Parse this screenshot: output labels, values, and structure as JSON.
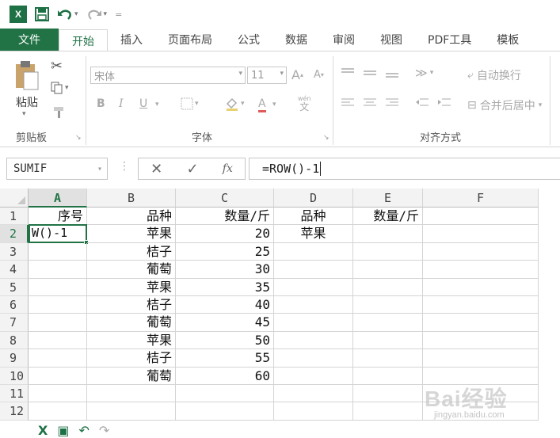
{
  "qat": {
    "logo": "X│",
    "save_icon": "save-icon",
    "undo_icon": "undo-icon",
    "redo_icon": "redo-icon",
    "customize_icon": "customize-qat-icon"
  },
  "tabs": [
    {
      "label": "文件"
    },
    {
      "label": "开始"
    },
    {
      "label": "插入"
    },
    {
      "label": "页面布局"
    },
    {
      "label": "公式"
    },
    {
      "label": "数据"
    },
    {
      "label": "审阅"
    },
    {
      "label": "视图"
    },
    {
      "label": "PDF工具"
    },
    {
      "label": "模板"
    }
  ],
  "ribbon": {
    "clipboard": {
      "paste_label": "粘贴",
      "group_label": "剪贴板"
    },
    "font": {
      "font_name": "宋体",
      "font_size": "11",
      "grow_label": "A",
      "shrink_label": "A",
      "bold_label": "B",
      "italic_label": "I",
      "underline_label": "U",
      "font_color_label": "A",
      "group_label": "字体"
    },
    "alignment": {
      "wrap_label": "自动换行",
      "merge_label": "合并后居中",
      "group_label": "对齐方式"
    }
  },
  "formula_bar": {
    "name_box": "SUMIF",
    "formula": "=ROW()-1"
  },
  "grid": {
    "columns": [
      "A",
      "B",
      "C",
      "D",
      "E",
      "F"
    ],
    "rows": [
      "1",
      "2",
      "3",
      "4",
      "5",
      "6",
      "7",
      "8",
      "9",
      "10",
      "11",
      "12"
    ],
    "active_cell_text": "W()-1",
    "cells": {
      "A1": "序号",
      "B1": "品种",
      "C1": "数量/斤",
      "D1": "品种",
      "E1": "数量/斤",
      "B2": "苹果",
      "C2": "20",
      "D2": "苹果",
      "B3": "桔子",
      "C3": "25",
      "B4": "葡萄",
      "C4": "30",
      "B5": "苹果",
      "C5": "35",
      "B6": "桔子",
      "C6": "40",
      "B7": "葡萄",
      "C7": "45",
      "B8": "苹果",
      "C8": "50",
      "B9": "桔子",
      "C9": "55",
      "B10": "葡萄",
      "C10": "60"
    }
  },
  "watermark": {
    "main": "Bai经验",
    "sub": "jingyan.baidu.com"
  },
  "colors": {
    "excel_green": "#217346",
    "grid_line": "#d4d4d4"
  }
}
